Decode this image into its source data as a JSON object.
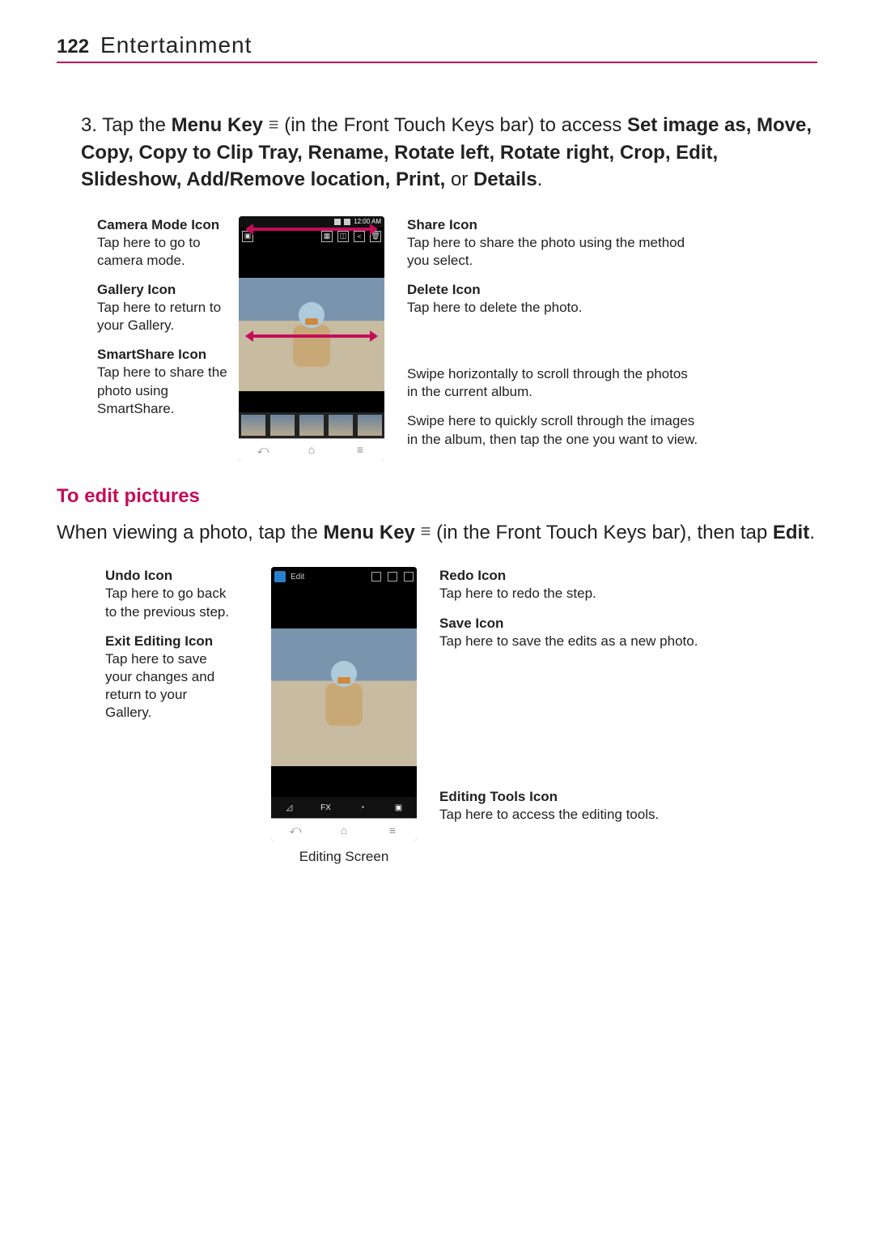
{
  "header": {
    "page_number": "122",
    "chapter_title": "Entertainment"
  },
  "step3": {
    "prefix": "3. Tap the ",
    "menu_key_label": "Menu Key",
    "mid1": " (in the Front Touch Keys bar) to access ",
    "bold_list": "Set image as, Move, Copy, Copy to Clip Tray, Rename, Rotate left, Rotate right, Crop, Edit, Slideshow, Add/Remove location, Print,",
    "or": " or ",
    "details": "Details",
    "period": "."
  },
  "diagram1": {
    "left": {
      "camera": {
        "title": "Camera Mode Icon",
        "desc": "Tap here to go to camera mode."
      },
      "gallery": {
        "title": "Gallery Icon",
        "desc": "Tap here to return to your Gallery."
      },
      "smartshare": {
        "title": "SmartShare Icon",
        "desc": "Tap here to share the photo using SmartShare."
      }
    },
    "right": {
      "share": {
        "title": "Share Icon",
        "desc": "Tap here to share the photo using the method you select."
      },
      "delete": {
        "title": "Delete Icon",
        "desc": "Tap here to delete the photo."
      },
      "swipe_h": "Swipe horizontally to scroll through the photos in the current album.",
      "swipe_thumb": "Swipe here to quickly scroll through the images in the album, then tap the one you want to view."
    },
    "status_time": "12:00 AM"
  },
  "section2": {
    "heading": "To edit pictures",
    "para_prefix": "When viewing a photo, tap the ",
    "menu_key_label": "Menu Key",
    "para_mid": " (in the Front Touch Keys bar), then tap ",
    "edit": "Edit",
    "period": "."
  },
  "diagram2": {
    "left": {
      "undo": {
        "title": "Undo Icon",
        "desc": "Tap here to go back to the previous step."
      },
      "exit": {
        "title": "Exit Editing Icon",
        "desc": "Tap here to save your changes and return to your Gallery."
      }
    },
    "right": {
      "redo": {
        "title": "Redo Icon",
        "desc": "Tap here to redo the step."
      },
      "save": {
        "title": "Save Icon",
        "desc": "Tap here to save the edits as a new photo."
      },
      "tools": {
        "title": "Editing Tools Icon",
        "desc": "Tap here to access the editing tools."
      }
    },
    "editbar_label": "Edit",
    "toolbar": {
      "fx": "FX"
    },
    "caption": "Editing Screen"
  },
  "softkeys": {
    "back": "⤺",
    "home": "⌂",
    "menu": "≡"
  }
}
